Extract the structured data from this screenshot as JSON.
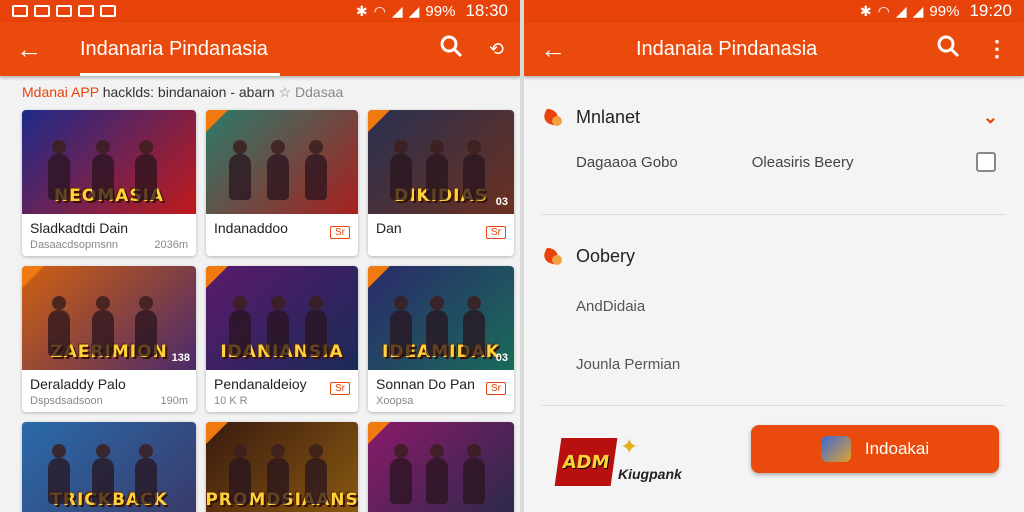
{
  "left": {
    "status": {
      "battery": "99%",
      "time": "18:30"
    },
    "appbar": {
      "title": "Indanaria Pindanasia"
    },
    "subhead": {
      "accent": "Mdanai APP",
      "text": "hacklds: bindanaion - abarn",
      "muted": "☆ Ddasaa"
    },
    "cards": [
      {
        "banner": "NEOMASIA",
        "name": "Sladkadtdi Dain",
        "sub_left": "Dasaacdsopmsnn",
        "sub_right": "2036m",
        "badge": "",
        "colors": [
          "#1e2a8a",
          "#c01a1a"
        ]
      },
      {
        "banner": "",
        "name": "Indanaddoo",
        "sub_left": "",
        "sub_right": "",
        "badge": "Sr",
        "colors": [
          "#2b7a6a",
          "#a82020"
        ]
      },
      {
        "banner": "DIKIDIAS",
        "name": "Dan",
        "sub_left": "",
        "sub_right": "",
        "badge": "Sr",
        "art_badge": "03",
        "colors": [
          "#2a3050",
          "#6a3020"
        ]
      },
      {
        "banner": "ZAERIMION",
        "name": "Deraladdy Palo",
        "sub_left": "Dspsdsadsoon",
        "sub_right": "190m",
        "badge": "",
        "art_badge": "138",
        "colors": [
          "#d06010",
          "#4a2a6a"
        ]
      },
      {
        "banner": "IDANIANSIA",
        "name": "Pendanaldeioy",
        "sub_left": "10 K R",
        "sub_right": "",
        "badge": "Sr",
        "colors": [
          "#5a1a6a",
          "#1a2a5a"
        ]
      },
      {
        "banner": "IDEAMIDAK",
        "name": "Sonnan Do Pan",
        "sub_left": "Xoopsa",
        "sub_right": "",
        "badge": "Sr",
        "art_badge": "03",
        "colors": [
          "#2a2a6a",
          "#1a6a5a"
        ]
      },
      {
        "banner": "TRICKBACK",
        "name": "",
        "sub_left": "",
        "sub_right": "",
        "badge": "",
        "colors": [
          "#2a6aaa",
          "#3a3a6a"
        ]
      },
      {
        "banner": "PROMDSIAANS",
        "name": "",
        "sub_left": "",
        "sub_right": "",
        "badge": "",
        "colors": [
          "#3a1a10",
          "#8a5a10"
        ]
      },
      {
        "banner": "",
        "name": "",
        "sub_left": "",
        "sub_right": "",
        "badge": "",
        "colors": [
          "#8a1a6a",
          "#2a2a4a"
        ]
      }
    ]
  },
  "right": {
    "status": {
      "battery": "99%",
      "time": "19:20"
    },
    "appbar": {
      "title": "Indanaia Pindanasia"
    },
    "section1": {
      "title": "Mnlanet",
      "option_a": "Dagaaoa Gobo",
      "option_b": "Oleasiris Beery"
    },
    "section2": {
      "title": "Oobery",
      "item1": "AndDidaia",
      "item2": "Jounla Permian"
    },
    "footer": {
      "logo_a": "ADM",
      "logo_b": "Kiugpank",
      "cta": "Indoakai"
    }
  }
}
